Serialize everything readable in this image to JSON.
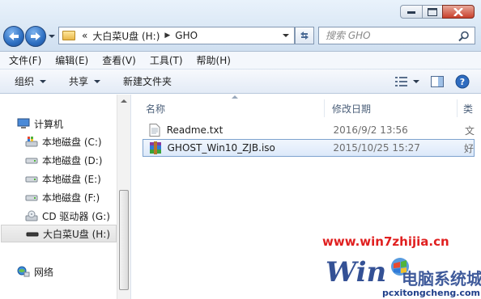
{
  "address": {
    "overflow": "«",
    "crumbs": [
      "大白菜U盘 (H:)",
      "GHO"
    ]
  },
  "search": {
    "placeholder": "搜索 GHO"
  },
  "menu": [
    "文件(F)",
    "编辑(E)",
    "查看(V)",
    "工具(T)",
    "帮助(H)"
  ],
  "toolbar": {
    "organize": "组织",
    "share": "共享",
    "new_folder": "新建文件夹"
  },
  "nav": {
    "computer": "计算机",
    "drives": [
      {
        "label": "本地磁盘 (C:)",
        "icon": "system-drive-icon"
      },
      {
        "label": "本地磁盘 (D:)",
        "icon": "hard-drive-icon"
      },
      {
        "label": "本地磁盘 (E:)",
        "icon": "hard-drive-icon"
      },
      {
        "label": "本地磁盘 (F:)",
        "icon": "hard-drive-icon"
      },
      {
        "label": "CD 驱动器 (G:)",
        "icon": "cd-drive-icon"
      },
      {
        "label": "大白菜U盘 (H:)",
        "icon": "usb-drive-icon",
        "selected": true
      }
    ],
    "network": "网络"
  },
  "columns": {
    "name": "名称",
    "date": "修改日期",
    "type": "类"
  },
  "files": [
    {
      "name": "Readme.txt",
      "date": "2016/9/2 13:56",
      "type": "文",
      "icon": "text-file-icon"
    },
    {
      "name": "GHOST_Win10_ZJB.iso",
      "date": "2015/10/25 15:27",
      "type": "好",
      "icon": "winrar-archive-icon",
      "selected": true
    }
  ],
  "watermark": {
    "url": "www.win7zhijia.cn",
    "sub": "pcxitongcheng.com",
    "brand": "电脑系统城"
  },
  "colors": {
    "chrome": "#dce9f6",
    "selection": "#dce9fa",
    "watermark_red": "#e02020"
  }
}
